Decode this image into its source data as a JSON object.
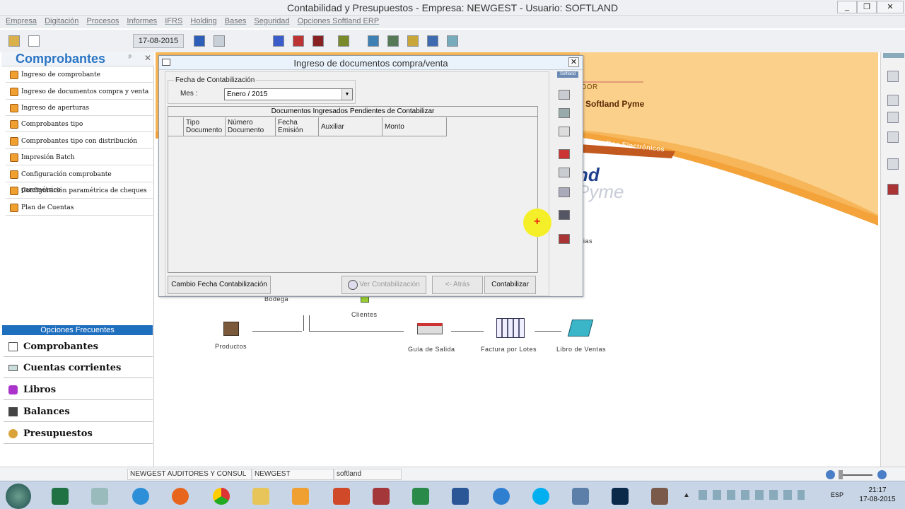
{
  "window": {
    "title": "Contabilidad y Presupuestos - Empresa: NEWGEST - Usuario: SOFTLAND"
  },
  "menu": [
    "Empresa",
    "Digitación",
    "Procesos",
    "Informes",
    "IFRS",
    "Holding",
    "Bases",
    "Seguridad",
    "Opciones Softland ERP"
  ],
  "toolbar": {
    "date": "17-08-2015"
  },
  "left_panel": {
    "title": "Comprobantes",
    "items": [
      "Ingreso de comprobante",
      "Ingreso de documentos compra y venta",
      "Ingreso de aperturas",
      "Comprobantes tipo",
      "Comprobantes tipo con distribución",
      "Impresión Batch",
      "Configuración comprobante paramétrico",
      "Configuración paramétrica de cheques",
      "Plan de Cuentas"
    ],
    "frequent_title": "Opciones Frecuentes",
    "frequent": [
      "Comprobantes",
      "Cuentas corrientes",
      "Libros",
      "Balances",
      "Presupuestos"
    ]
  },
  "dialog": {
    "title": "Ingreso de documentos compra/venta",
    "fecha_legend": "Fecha de Contabilización",
    "mes_label": "Mes :",
    "mes_value": "Enero / 2015",
    "grid_title": "Documentos Ingresados Pendientes de Contabilizar",
    "columns": [
      "Tipo Documento",
      "Número Documento",
      "Fecha Emisión",
      "Auxiliar",
      "Monto"
    ],
    "buttons": {
      "cambio": "Cambio Fecha Contabilización",
      "ver": "Ver Contabilización",
      "atras": "<- Atrás",
      "contabilizar": "Contabilizar"
    }
  },
  "background": {
    "brand_fragment": "DOR",
    "brand_text": "Softland Pyme",
    "tab": "Doc.Electrónicos",
    "logo_fragment1": "nd",
    "logo_fragment2": "Pyme",
    "side_label": "Softland",
    "partial_label": "cias",
    "flow_labels": [
      "Bodega",
      "Clientes",
      "Productos",
      "Guía de Salida",
      "Factura por Lotes",
      "Libro de Ventas"
    ]
  },
  "statusbar": {
    "empresa": "NEWGEST AUDITORES Y CONSUL",
    "codigo": "NEWGEST",
    "usuario": "softland"
  },
  "taskbar": {
    "lang": "ESP",
    "time": "21:17",
    "date": "17-08-2015"
  }
}
